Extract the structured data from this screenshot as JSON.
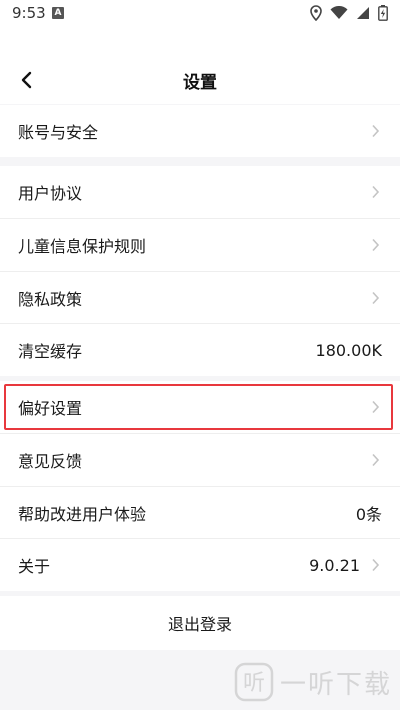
{
  "status_bar": {
    "time": "9:53",
    "notification_icon": "A"
  },
  "header": {
    "title": "设置"
  },
  "settings": [
    {
      "label": "账号与安全",
      "value": ""
    },
    {
      "label": "用户协议",
      "value": ""
    },
    {
      "label": "儿童信息保护规则",
      "value": ""
    },
    {
      "label": "隐私政策",
      "value": ""
    },
    {
      "label": "清空缓存",
      "value": "180.00K"
    },
    {
      "label": "偏好设置",
      "value": ""
    },
    {
      "label": "意见反馈",
      "value": ""
    },
    {
      "label": "帮助改进用户体验",
      "value": "0条"
    },
    {
      "label": "关于",
      "value": "9.0.21"
    }
  ],
  "logout": {
    "label": "退出登录"
  },
  "watermark": {
    "text": "一听下载"
  },
  "colors": {
    "highlight": "#e8383d",
    "background": "#f5f5f7",
    "chevron": "#c4c4c4"
  }
}
